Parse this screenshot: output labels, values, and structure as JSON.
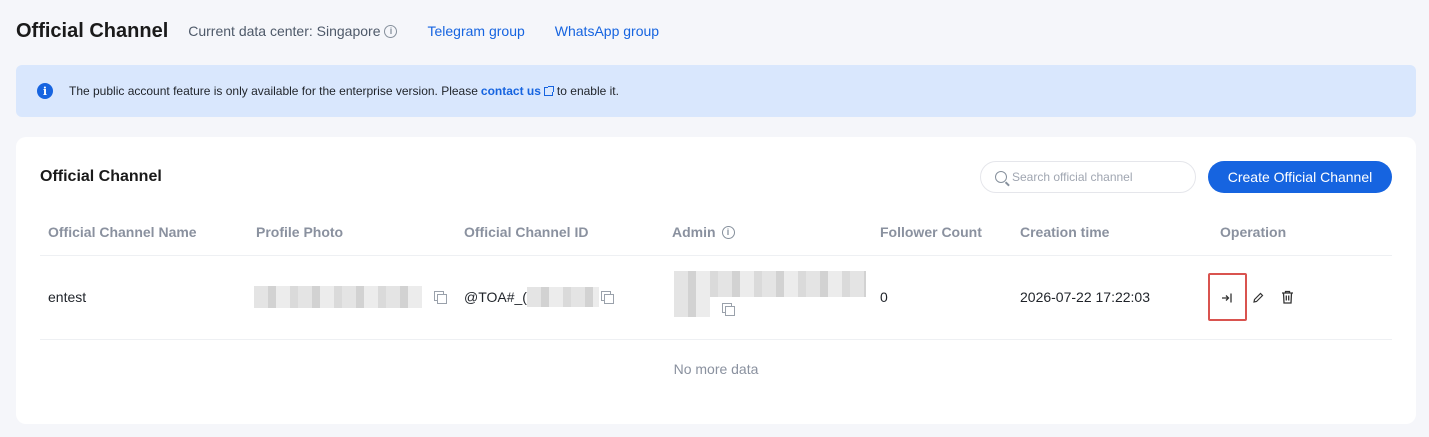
{
  "header": {
    "title": "Official Channel",
    "data_center": "Current data center: Singapore",
    "links": [
      "Telegram group",
      "WhatsApp group"
    ]
  },
  "notice": {
    "text_before": "The public account feature is only available for the enterprise version. Please",
    "link": "contact us",
    "text_after": "to enable it."
  },
  "card": {
    "title": "Official Channel",
    "search_placeholder": "Search official channel",
    "create_label": "Create Official Channel"
  },
  "table": {
    "columns": [
      "Official Channel Name",
      "Profile Photo",
      "Official Channel ID",
      "Admin",
      "Follower Count",
      "Creation time",
      "Operation"
    ],
    "rows": [
      {
        "name": "entest",
        "channel_id": "@TOA#_(",
        "follower_count": "0",
        "creation_time": "2026-07-22 17:22:03"
      }
    ],
    "empty_text": "No more data"
  },
  "colors": {
    "primary": "#1664e0",
    "notice_bg": "#d9e7fd",
    "highlight": "#d9534f"
  }
}
